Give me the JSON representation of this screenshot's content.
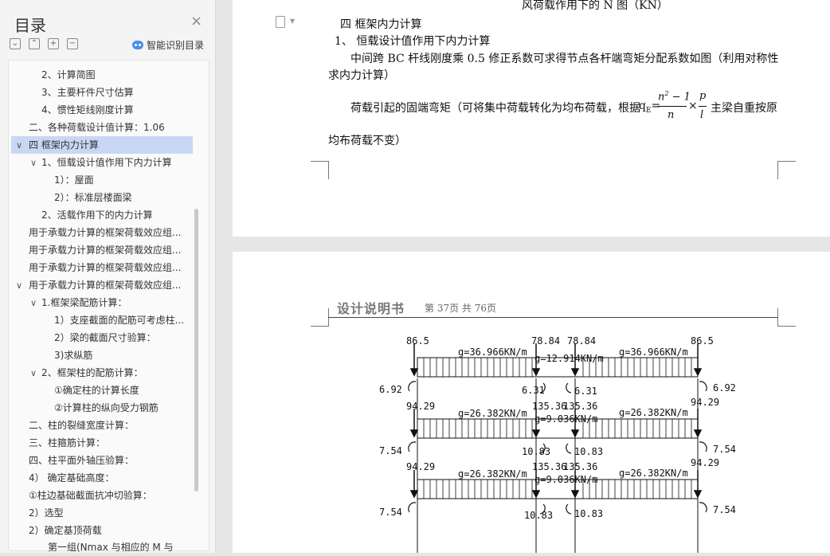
{
  "sidebar": {
    "title": "目录",
    "close": "×",
    "smart_toc": "智能识别目录",
    "tools": [
      "⌄",
      "⌃",
      "+",
      "−"
    ],
    "items": [
      {
        "label": "2、计算简图"
      },
      {
        "label": "3、主要杆件尺寸估算"
      },
      {
        "label": "4、惯性矩线刚度计算"
      },
      {
        "label": "二、各种荷载设计值计算：1.06"
      },
      {
        "label": "四 框架内力计算"
      },
      {
        "label": "1、恒载设计值作用下内力计算"
      },
      {
        "label": "1）：屋面"
      },
      {
        "label": "2）：标准层楼面梁"
      },
      {
        "label": "2、活载作用下的内力计算"
      },
      {
        "label": "用于承载力计算的框架荷载效应组..."
      },
      {
        "label": "用于承载力计算的框架荷载效应组..."
      },
      {
        "label": "用于承载力计算的框架荷载效应组..."
      },
      {
        "label": "用于承载力计算的框架荷载效应组..."
      },
      {
        "label": "1.框架梁配筋计算："
      },
      {
        "label": "1）支座截面的配筋可考虑柱..."
      },
      {
        "label": "2）梁的截面尺寸验算："
      },
      {
        "label": "3)求纵筋"
      },
      {
        "label": "2、框架柱的配筋计算："
      },
      {
        "label": "①确定柱的计算长度"
      },
      {
        "label": "②计算柱的纵向受力钢筋"
      },
      {
        "label": "二、柱的裂缝宽度计算："
      },
      {
        "label": "三、柱箍筋计算："
      },
      {
        "label": "四、柱平面外轴压验算："
      },
      {
        "label": "4） 确定基础高度："
      },
      {
        "label": "①柱边基础截面抗冲切验算："
      },
      {
        "label": "2）选型"
      },
      {
        "label": "2）确定基顶荷载"
      },
      {
        "label": "第一组(Nmax 与相应的 M 与"
      }
    ]
  },
  "doc": {
    "top_cut": "风荷载作用下的 N 图（KN）",
    "sec_title": "四 框架内力计算",
    "sub_title": "1、 恒载设计值作用下内力计算",
    "para1a": "中间跨 BC 杆线刚度乘 0.5 修正系数可求得节点各杆端弯矩分配系数如图（利用对称性",
    "para1b": "求内力计算）",
    "para2a": "荷载引起的固端弯矩（可将集中荷载转化为均布荷载，根据",
    "para2_q": "q",
    "para2_sub": "E",
    "para2_eq": "=",
    "para2_n2": "n",
    "para2_sup": "2",
    "para2_minus1": " − 1",
    "para2_n": "n",
    "para2_times": "×",
    "para2_p": "p",
    "para2_l": "l",
    "para2b": "主梁自重按原",
    "para2c": "均布荷载不变）",
    "header_title": "设计说明书",
    "header_page": "第 37页 共 76页"
  },
  "diagram": {
    "top": {
      "left": "86.5",
      "mid_l": "78.84",
      "mid_r": "78.84",
      "right": "86.5"
    },
    "rows": [
      {
        "load_l": "g=36.966KN/m",
        "load_m": "g=12.914KN/m",
        "load_r": "g=36.966KN/m",
        "end_l": "6.92",
        "end_r": "6.92",
        "mid_l": "6.31",
        "mid_r": "6.31"
      },
      {
        "top_l": "94.29",
        "top_ml": "135.36",
        "top_mr": "135.36",
        "top_r": "94.29",
        "load_l": "g=26.382KN/m",
        "load_m": "g=9.036KN/m",
        "load_r": "g=26.382KN/m",
        "end_l": "7.54",
        "end_r": "7.54",
        "mid_l": "10.83",
        "mid_r": "10.83"
      },
      {
        "top_l": "94.29",
        "top_ml": "135.36",
        "top_mr": "135.36",
        "top_r": "94.29",
        "load_l": "g=26.382KN/m",
        "load_m": "g=9.036KN/m",
        "load_r": "g=26.382KN/m",
        "end_l": "7.54",
        "end_r": "7.54",
        "mid_l": "10.83",
        "mid_r": "10.83"
      }
    ]
  }
}
